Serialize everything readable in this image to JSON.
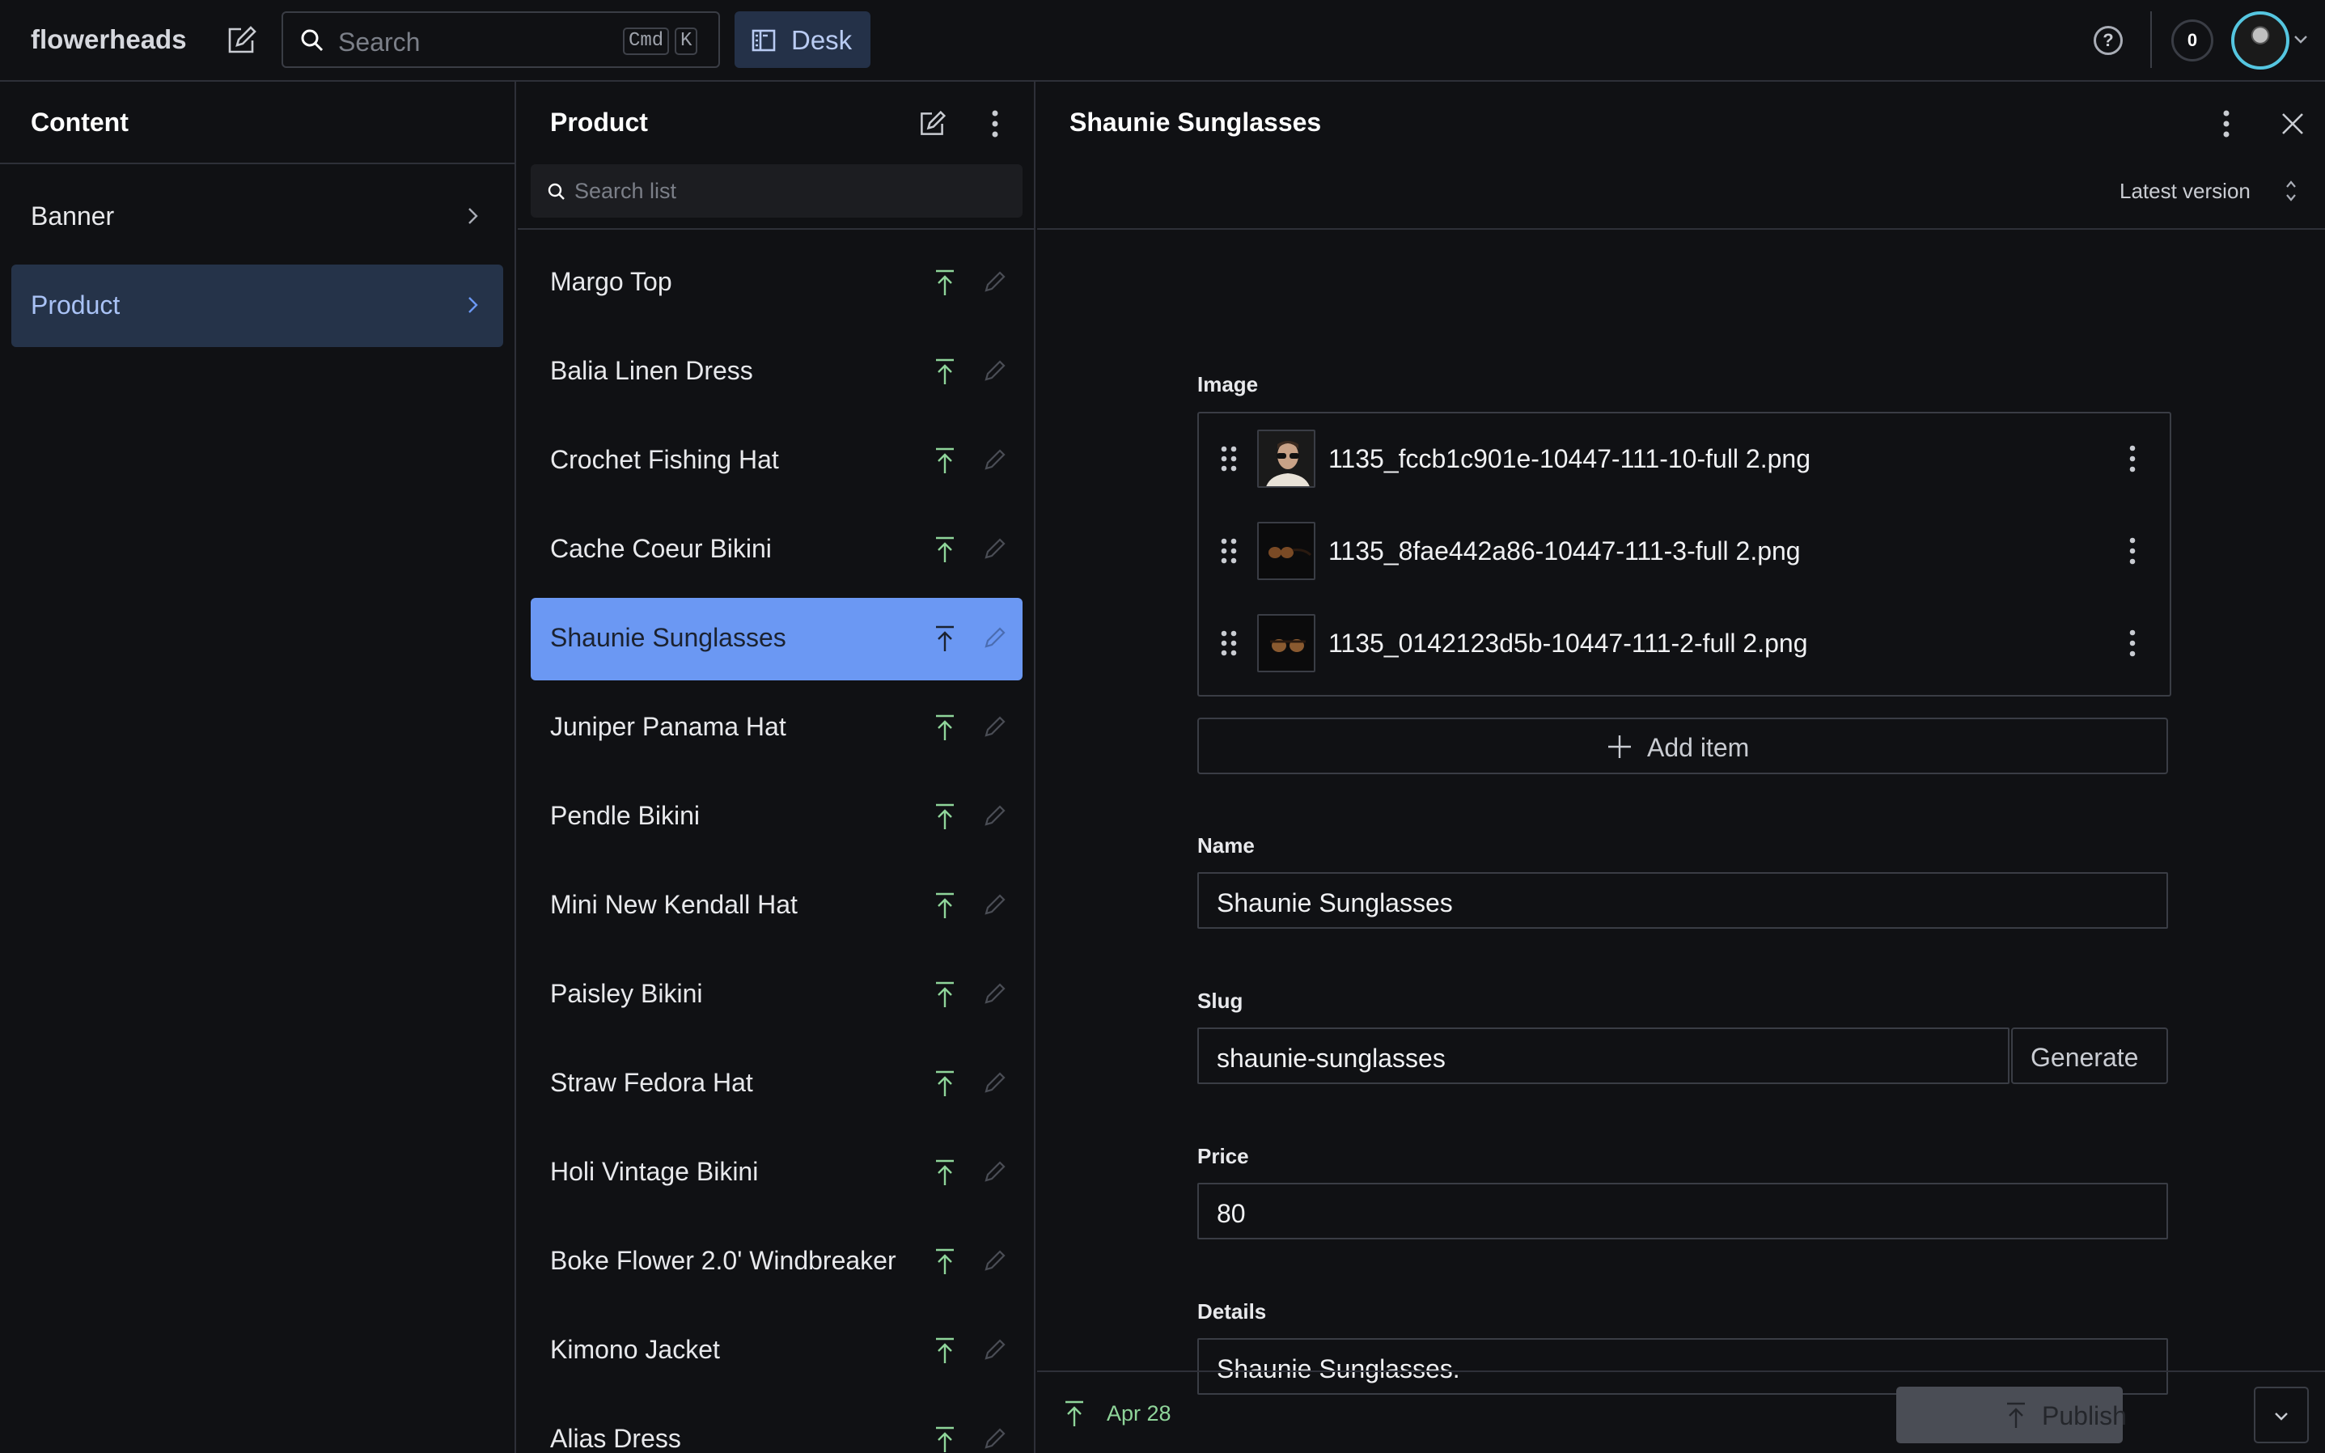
{
  "topbar": {
    "brand": "flowerheads",
    "search_placeholder": "Search",
    "shortcut_keys": [
      "Cmd",
      "K"
    ],
    "desk_label": "Desk",
    "notification_count": "0",
    "help_glyph": "?"
  },
  "content_panel": {
    "title": "Content",
    "items": [
      {
        "label": "Banner",
        "active": false
      },
      {
        "label": "Product",
        "active": true
      }
    ]
  },
  "list_panel": {
    "title": "Product",
    "search_placeholder": "Search list",
    "items": [
      {
        "label": "Margo Top"
      },
      {
        "label": "Balia Linen Dress"
      },
      {
        "label": "Crochet Fishing Hat"
      },
      {
        "label": "Cache Coeur Bikini"
      },
      {
        "label": "Shaunie Sunglasses",
        "active": true
      },
      {
        "label": "Juniper Panama Hat"
      },
      {
        "label": "Pendle Bikini"
      },
      {
        "label": "Mini New Kendall Hat"
      },
      {
        "label": "Paisley Bikini"
      },
      {
        "label": "Straw Fedora Hat"
      },
      {
        "label": "Holi Vintage Bikini"
      },
      {
        "label": "Boke Flower 2.0' Windbreaker"
      },
      {
        "label": "Kimono Jacket"
      },
      {
        "label": "Alias Dress"
      }
    ]
  },
  "document": {
    "title": "Shaunie Sunglasses",
    "version_label": "Latest version",
    "fields": {
      "image": {
        "label": "Image",
        "items": [
          {
            "filename": "1135_fccb1c901e-10447-111-10-full 2.png",
            "thumb": "model-wearing-sunglasses"
          },
          {
            "filename": "1135_8fae442a86-10447-111-3-full 2.png",
            "thumb": "sunglasses-side"
          },
          {
            "filename": "1135_0142123d5b-10447-111-2-full 2.png",
            "thumb": "sunglasses-front"
          }
        ],
        "add_label": "Add item"
      },
      "name": {
        "label": "Name",
        "value": "Shaunie Sunglasses"
      },
      "slug": {
        "label": "Slug",
        "value": "shaunie-sunglasses",
        "generate_label": "Generate"
      },
      "price": {
        "label": "Price",
        "value": "80"
      },
      "details": {
        "label": "Details",
        "value": "Shaunie Sunglasses."
      }
    },
    "footer": {
      "published_date": "Apr 28",
      "publish_label": "Publish"
    }
  },
  "colors": {
    "accent_blue": "#6b98f3",
    "published_green": "#8fd59a",
    "avatar_ring": "#55c6e0",
    "nav_active_bg": "#253349"
  }
}
